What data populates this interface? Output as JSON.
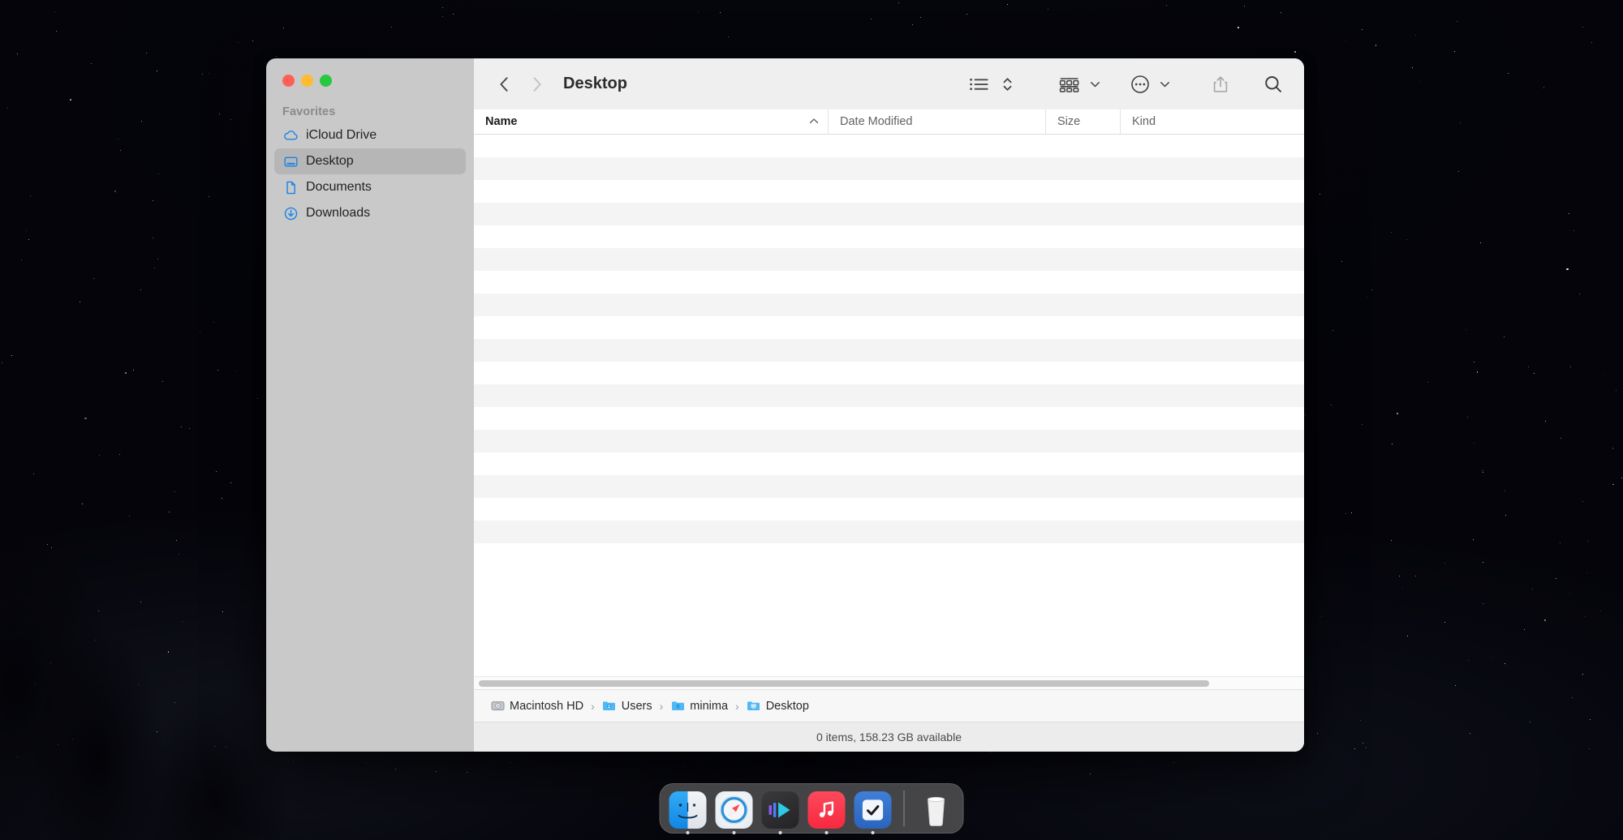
{
  "window": {
    "title": "Desktop",
    "traffic_lights": [
      "close",
      "minimize",
      "maximize"
    ],
    "colors": {
      "close": "#ff5f57",
      "minimize": "#febc2e",
      "maximize": "#28c840",
      "sidebar_bg": "#c9c9c9",
      "toolbar_bg": "#efefef",
      "selection": "#b6b6b6",
      "accent_blue": "#1a84e8"
    }
  },
  "sidebar": {
    "section_header": "Favorites",
    "items": [
      {
        "label": "iCloud Drive",
        "icon": "cloud-icon",
        "selected": false
      },
      {
        "label": "Desktop",
        "icon": "desktop-icon",
        "selected": true
      },
      {
        "label": "Documents",
        "icon": "document-icon",
        "selected": false
      },
      {
        "label": "Downloads",
        "icon": "download-icon",
        "selected": false
      }
    ]
  },
  "toolbar": {
    "back_label": "Back",
    "forward_label": "Forward",
    "back_icon": "chevron-left-icon",
    "forward_icon": "chevron-right-icon",
    "view_list_icon": "list-view-icon",
    "sort_icon": "sort-updown-icon",
    "group_icon": "group-by-icon",
    "group_chevron_icon": "chevron-down-icon",
    "action_icon": "more-actions-icon",
    "action_chevron_icon": "chevron-down-icon",
    "share_icon": "share-icon",
    "search_icon": "search-icon"
  },
  "columns": [
    {
      "label": "Name",
      "sort": "ascending",
      "sort_icon": "chevron-up-icon"
    },
    {
      "label": "Date Modified",
      "sort": "none"
    },
    {
      "label": "Size",
      "sort": "none"
    },
    {
      "label": "Kind",
      "sort": "none"
    }
  ],
  "file_list": {
    "rows": [],
    "empty": true,
    "visible_stripes": 19
  },
  "path_bar": {
    "crumbs": [
      {
        "label": "Macintosh HD",
        "icon": "harddisk-icon"
      },
      {
        "label": "Users",
        "icon": "folder-users-icon"
      },
      {
        "label": "minima",
        "icon": "folder-home-icon"
      },
      {
        "label": "Desktop",
        "icon": "folder-desktop-icon"
      }
    ],
    "separator": "›"
  },
  "status_bar": {
    "text": "0 items, 158.23 GB available"
  },
  "dock": {
    "items": [
      {
        "label": "Finder",
        "icon": "finder-icon",
        "running": true
      },
      {
        "label": "Safari",
        "icon": "safari-icon",
        "running": true
      },
      {
        "label": "Player",
        "icon": "media-player-icon",
        "running": true
      },
      {
        "label": "Music",
        "icon": "music-icon",
        "running": true
      },
      {
        "label": "Reminders",
        "icon": "checkmark-icon",
        "running": true
      }
    ],
    "trash": {
      "label": "Trash",
      "icon": "trash-icon"
    }
  }
}
